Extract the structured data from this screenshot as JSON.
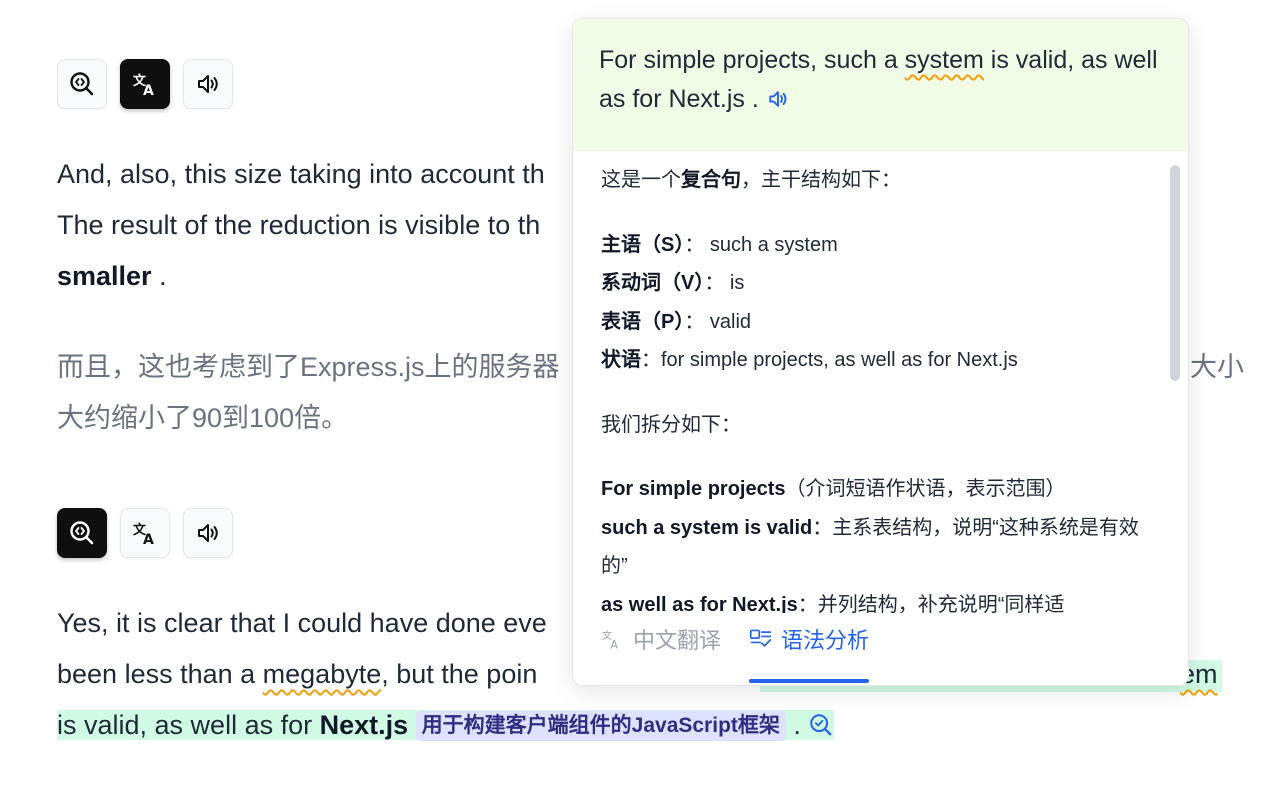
{
  "toolbars": {
    "first": {
      "active": "translate"
    },
    "second": {
      "active": "analyze"
    }
  },
  "para1": {
    "line1": "And, also, this size taking into account th",
    "line2": "The result of the reduction is visible to th",
    "bold": "smaller",
    "end": " ."
  },
  "para1_zh": {
    "line1": "而且，这也考虑到了Express.js上的服务器",
    "line1_right": "大小",
    "line2": "大约缩小了90到100倍。"
  },
  "para2": {
    "line1": "Yes, it is clear that I could have done eve",
    "line2_pre": "been less than a ",
    "line2_wavy": "megabyte",
    "line2_post": ", but the poin",
    "line2_right_wavy": "em",
    "line3_pre": "is valid, as well as for ",
    "line3_bold": "Next.js",
    "tag": "用于构建客户端组件的JavaScript框架",
    "line3_end": " ."
  },
  "popup": {
    "sentence_pre": "For simple projects, such a ",
    "sentence_wavy": "system",
    "sentence_post": " is valid, as well as for Next.js .",
    "intro_pre": "这是一个",
    "intro_bold": "复合句",
    "intro_post": "，主干结构如下：",
    "subject_label": "主语（S）",
    "subject_value": "such a system",
    "verb_label": "系动词（V）",
    "verb_value": "is",
    "pred_label": "表语（P）",
    "pred_value": "valid",
    "adv_label": "状语",
    "adv_value": "for simple projects, as well as for Next.js",
    "split_intro": "我们拆分如下：",
    "item1_bold": "For simple projects",
    "item1_rest": "（介词短语作状语，表示范围）",
    "item2_bold": "such a system is valid",
    "item2_rest": "：主系表结构，说明“这种系统是有效的”",
    "item3_bold": "as well as for Next.js",
    "item3_rest": "：并列结构，补充说明“同样适",
    "tabs": [
      "中文翻译",
      "语法分析"
    ],
    "active_tab": "语法分析"
  },
  "colors": {
    "accent": "#2563eb",
    "highlight": "#d1fae5",
    "popup_head": "#f0fce6",
    "tag_bg": "#dde3ff",
    "wavy": "#f59e0b"
  }
}
